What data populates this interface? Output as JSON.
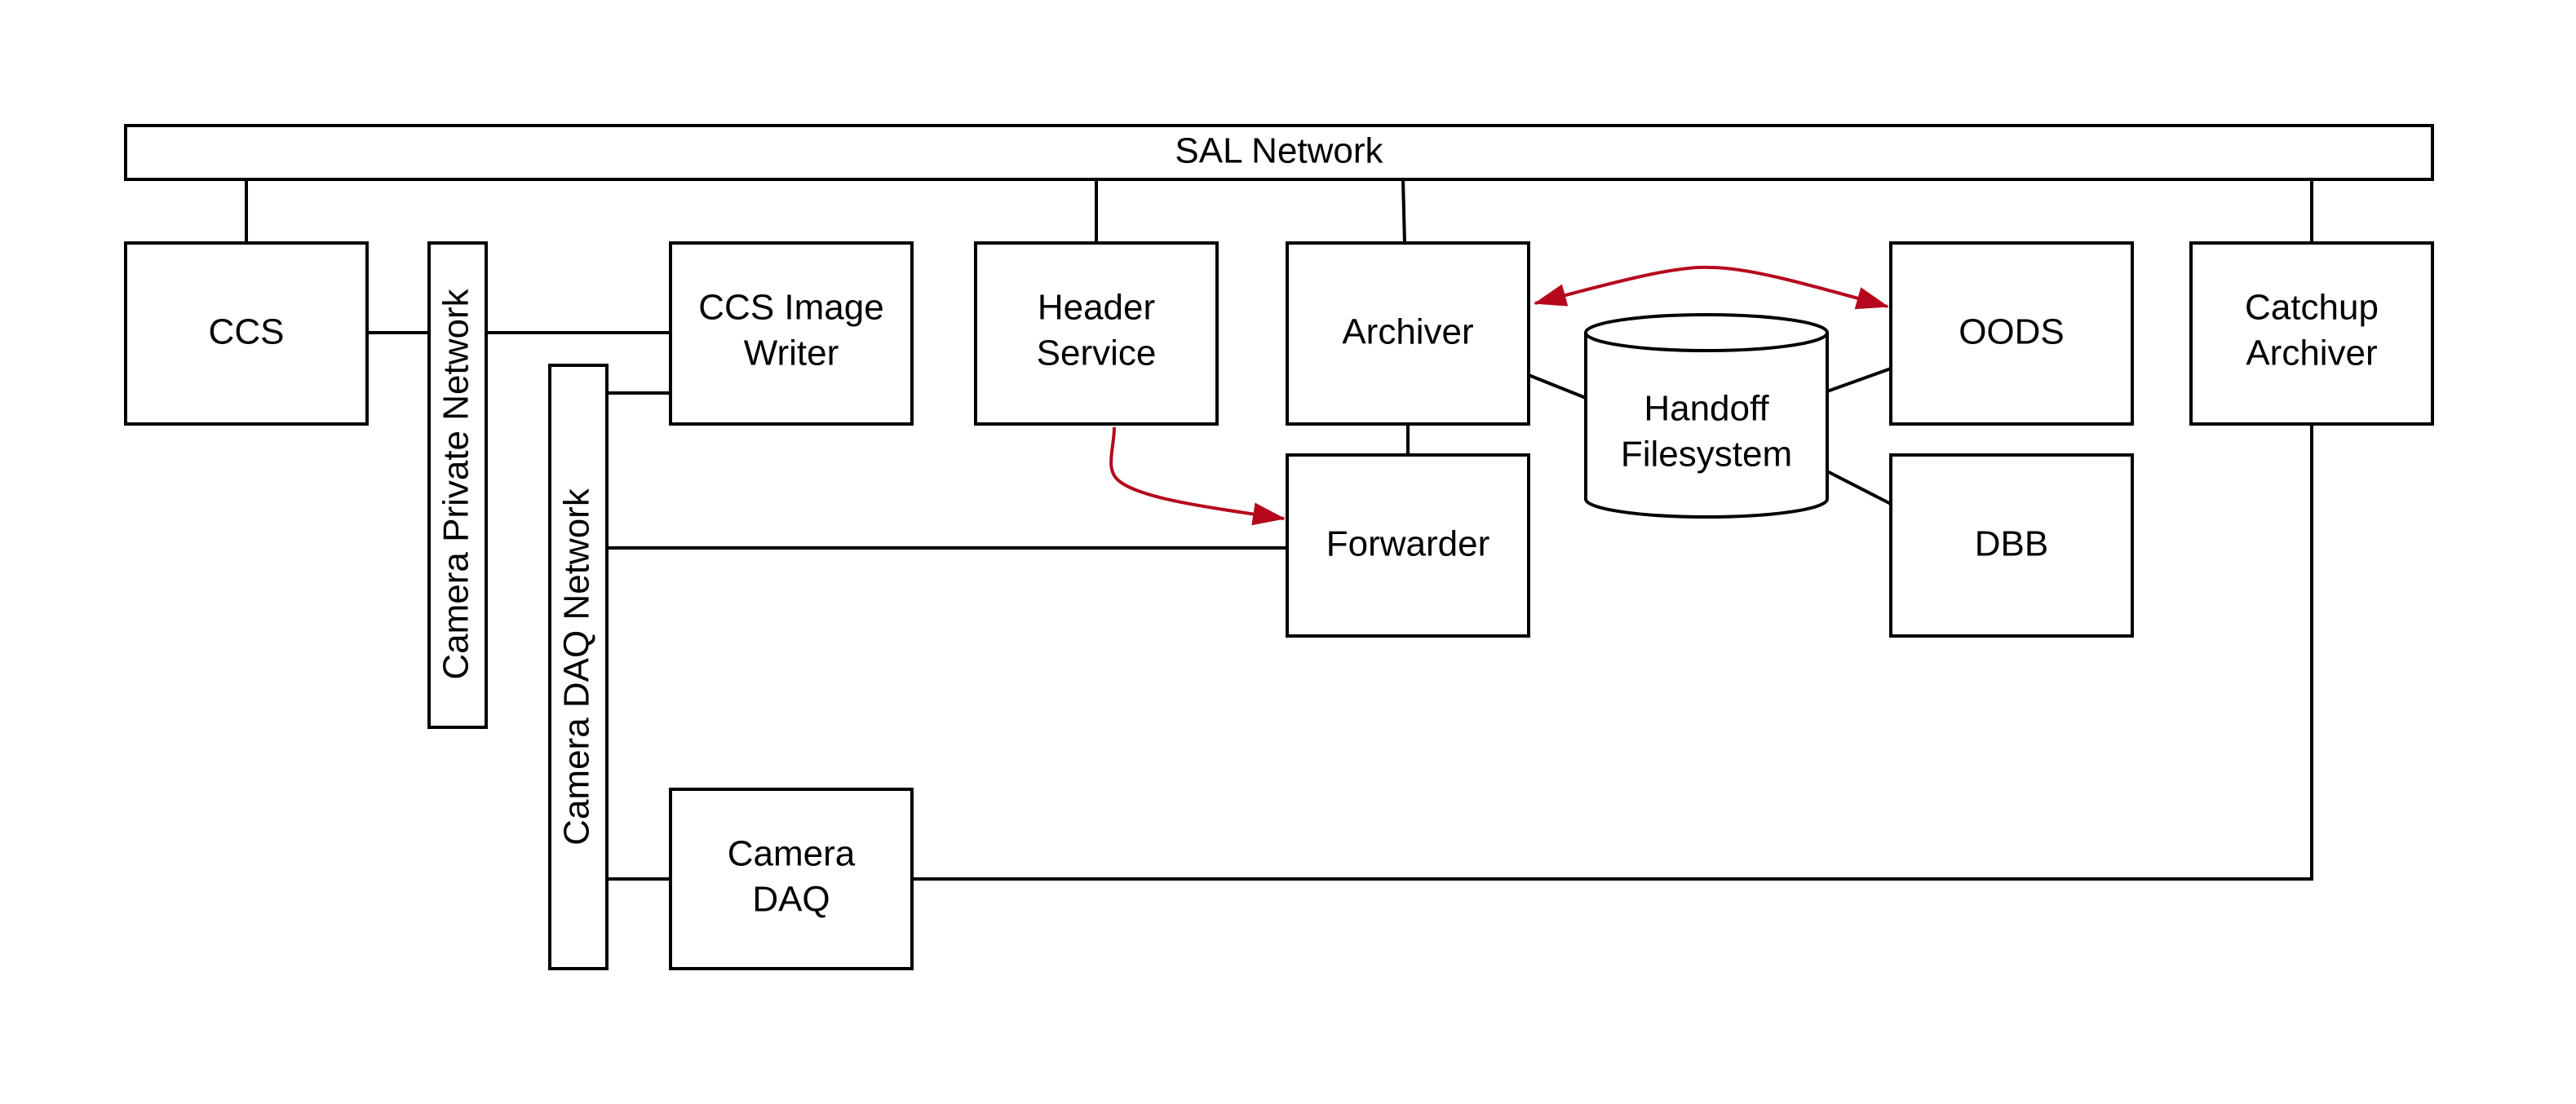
{
  "diagram": {
    "networks": {
      "sal": "SAL Network",
      "camera_private": "Camera Private Network",
      "camera_daq": "Camera DAQ Network"
    },
    "nodes": {
      "ccs": [
        "CCS"
      ],
      "ccs_image_writer": [
        "CCS Image",
        "Writer"
      ],
      "header_service": [
        "Header",
        "Service"
      ],
      "archiver": [
        "Archiver"
      ],
      "forwarder": [
        "Forwarder"
      ],
      "handoff_filesystem": [
        "Handoff",
        "Filesystem"
      ],
      "oods": [
        "OODS"
      ],
      "dbb": [
        "DBB"
      ],
      "catchup_archiver": [
        "Catchup",
        "Archiver"
      ],
      "camera_daq": [
        "Camera",
        "DAQ"
      ]
    },
    "colors": {
      "data_flow_arrow": "#b5081c",
      "line": "#000000"
    }
  }
}
